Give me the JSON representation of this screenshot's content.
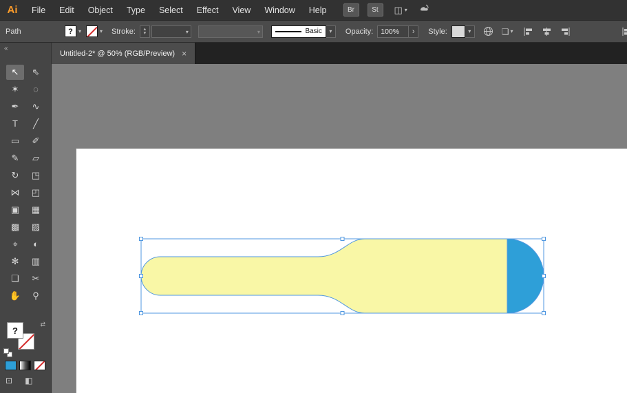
{
  "ui": {
    "dropdown_glyph": "▾",
    "spinner_up": "▴",
    "spinner_down": "▾",
    "chevron_right": "›"
  },
  "menu_bar": {
    "logo": "Ai",
    "items": [
      "File",
      "Edit",
      "Object",
      "Type",
      "Select",
      "Effect",
      "View",
      "Window",
      "Help"
    ],
    "bridge_button_label": "Br",
    "stock_button_label": "St",
    "workspace_icon_glyph": "◫"
  },
  "control_bar": {
    "selection_type_label": "Path",
    "fill_swatch_mark": "?",
    "stroke_word": "Stroke:",
    "brush_name": "Basic",
    "opacity_word": "Opacity:",
    "opacity_value": "100%",
    "style_word": "Style:",
    "doc_icon_glyph": "❏"
  },
  "tab_bar": {
    "active_tab_title": "Untitled-2* @ 50% (RGB/Preview)",
    "close_glyph": "×"
  },
  "toolbar": {
    "collapse_glyph": "«",
    "fill_swatch_mark": "?",
    "swap_glyph": "⇄",
    "draw_mode_glyph": "⊡",
    "screen_mode_glyph": "◧",
    "tools": [
      {
        "name": "selection-tool",
        "glyph": "↖",
        "selected": true
      },
      {
        "name": "direct-selection-tool",
        "glyph": "⇖"
      },
      {
        "name": "magic-wand-tool",
        "glyph": "✶"
      },
      {
        "name": "lasso-tool",
        "glyph": "◌"
      },
      {
        "name": "pen-tool",
        "glyph": "✒"
      },
      {
        "name": "curvature-tool",
        "glyph": "∿"
      },
      {
        "name": "type-tool",
        "glyph": "T"
      },
      {
        "name": "line-segment-tool",
        "glyph": "╱"
      },
      {
        "name": "rectangle-tool",
        "glyph": "▭"
      },
      {
        "name": "paintbrush-tool",
        "glyph": "✐"
      },
      {
        "name": "shaper-tool",
        "glyph": "✎"
      },
      {
        "name": "eraser-tool",
        "glyph": "▱"
      },
      {
        "name": "rotate-tool",
        "glyph": "↻"
      },
      {
        "name": "scale-tool",
        "glyph": "◳"
      },
      {
        "name": "width-tool",
        "glyph": "⋈"
      },
      {
        "name": "free-transform-tool",
        "glyph": "◰"
      },
      {
        "name": "shape-builder-tool",
        "glyph": "▣"
      },
      {
        "name": "perspective-grid-tool",
        "glyph": "▦"
      },
      {
        "name": "mesh-tool",
        "glyph": "▩"
      },
      {
        "name": "gradient-tool",
        "glyph": "▨"
      },
      {
        "name": "eyedropper-tool",
        "glyph": "⌖"
      },
      {
        "name": "blend-tool",
        "glyph": "◐"
      },
      {
        "name": "symbol-sprayer-tool",
        "glyph": "✻"
      },
      {
        "name": "column-graph-tool",
        "glyph": "▥"
      },
      {
        "name": "artboard-tool",
        "glyph": "❏"
      },
      {
        "name": "slice-tool",
        "glyph": "✂"
      },
      {
        "name": "hand-tool",
        "glyph": "✋"
      },
      {
        "name": "zoom-tool",
        "glyph": "⚲"
      }
    ]
  },
  "canvas": {
    "zoom_level": "50%",
    "selection_color": "#4f97e0",
    "shape": {
      "description": "horizontal bat/bottle shape selected on artboard",
      "body_color": "#f9f7a6",
      "cap_color": "#2e9fd8"
    }
  }
}
